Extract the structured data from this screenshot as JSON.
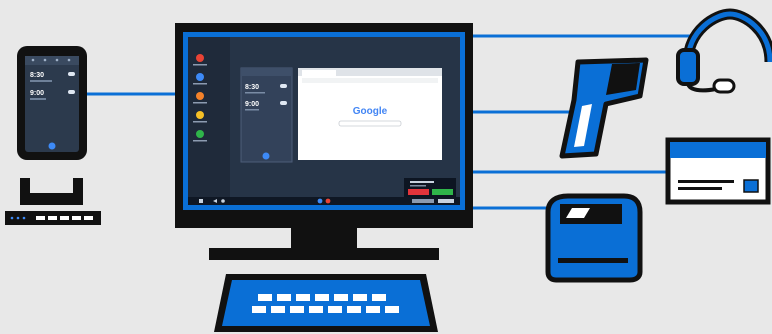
{
  "colors": {
    "background": "#e8e8e8",
    "accent_blue": "#0a6fd6",
    "outline": "#111111",
    "screen_dark": "#1f2a3a",
    "window_white": "#ffffff"
  },
  "phone": {
    "time_1": "8:30",
    "time_2": "9:00"
  },
  "desktop": {
    "phone_panel": {
      "time_1": "8:30",
      "time_2": "9:00"
    },
    "browser": {
      "logo_text": "Google"
    }
  },
  "icons": {
    "dock_phone": "smartphone-icon",
    "cradle": "dock-cradle-icon",
    "monitor": "monitor-icon",
    "keyboard": "keyboard-icon",
    "headset": "headset-icon",
    "scanner": "barcode-scanner-icon",
    "card": "id-card-icon",
    "printer": "printer-icon"
  }
}
